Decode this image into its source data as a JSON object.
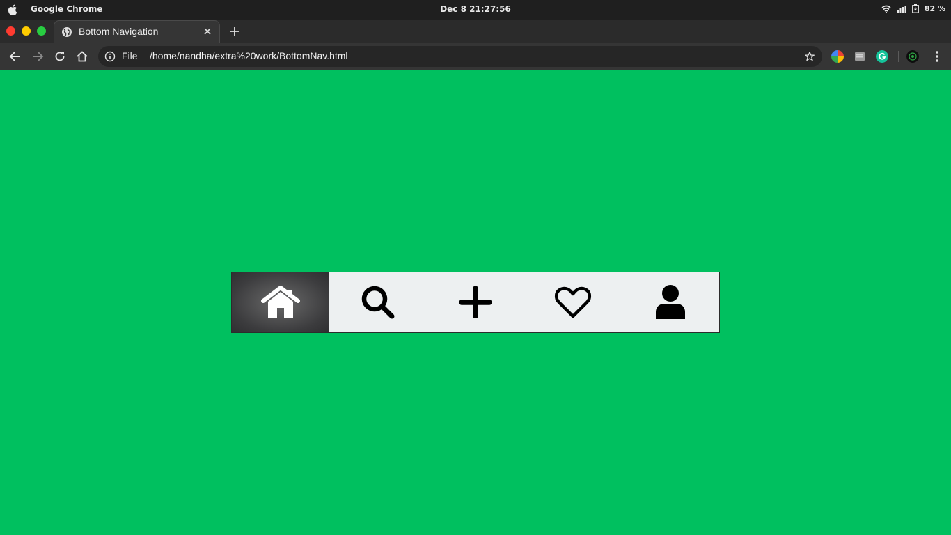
{
  "os_bar": {
    "app_name": "Google Chrome",
    "clock": "Dec 8  21:27:56",
    "battery": "82 %"
  },
  "browser": {
    "tab": {
      "title": "Bottom Navigation"
    },
    "address": {
      "scheme_label": "File",
      "url": "/home/nandha/extra%20work/BottomNav.html"
    }
  },
  "page": {
    "background_color": "#00c05f",
    "bottom_nav": {
      "active_index": 0,
      "items": [
        {
          "icon": "home-icon",
          "active": true
        },
        {
          "icon": "search-icon",
          "active": false
        },
        {
          "icon": "plus-icon",
          "active": false
        },
        {
          "icon": "heart-icon",
          "active": false
        },
        {
          "icon": "user-icon",
          "active": false
        }
      ]
    }
  }
}
